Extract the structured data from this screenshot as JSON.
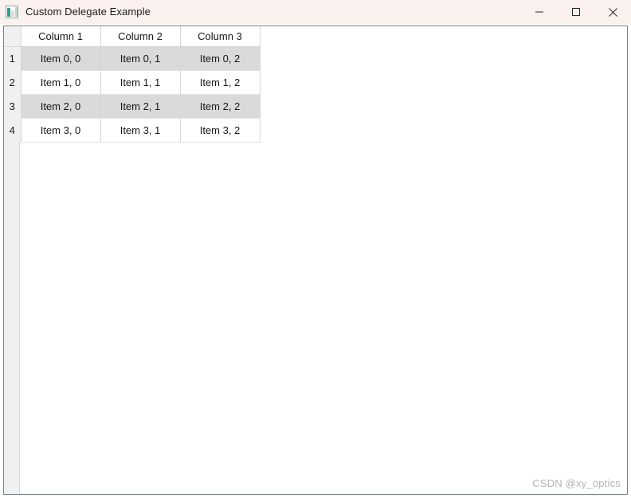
{
  "window": {
    "title": "Custom Delegate Example",
    "app_icon": "chart-window-icon",
    "titlebar_bg": "#faf0ee",
    "controls": [
      {
        "name": "minimize-button",
        "glyph": "minimize"
      },
      {
        "name": "maximize-button",
        "glyph": "maximize"
      },
      {
        "name": "close-button",
        "glyph": "close"
      }
    ]
  },
  "table": {
    "corner_label": "",
    "column_headers": [
      "Column 1",
      "Column 2",
      "Column 3"
    ],
    "row_headers": [
      "1",
      "2",
      "3",
      "4"
    ],
    "rows": [
      [
        "Item 0, 0",
        "Item 0, 1",
        "Item 0, 2"
      ],
      [
        "Item 1, 0",
        "Item 1, 1",
        "Item 1, 2"
      ],
      [
        "Item 2, 0",
        "Item 2, 1",
        "Item 2, 2"
      ],
      [
        "Item 3, 0",
        "Item 3, 1",
        "Item 3, 2"
      ]
    ],
    "alternating_row_color": "#dadada",
    "base_row_color": "#ffffff",
    "grid_line_color": "#d6d6d6",
    "header_background": "#f0f0f0"
  },
  "watermark": {
    "text": "CSDN @xy_optics",
    "color": "#b3b3b3"
  }
}
